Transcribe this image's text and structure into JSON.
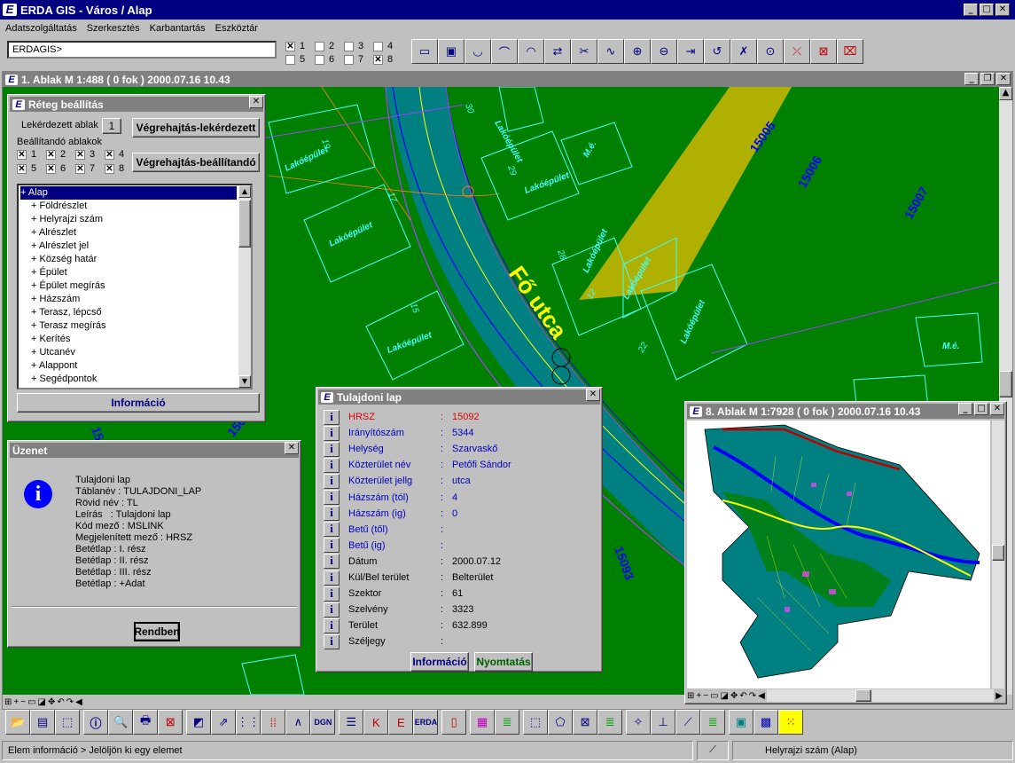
{
  "app": {
    "title": "ERDA GIS - Város / Alap",
    "logo": "ERDA"
  },
  "menu": [
    "Adatszolgáltatás",
    "Szerkesztés",
    "Karbantartás",
    "Eszköztár"
  ],
  "command": {
    "value": "ERDAGIS>"
  },
  "view_checks": [
    {
      "label": "1",
      "checked": true
    },
    {
      "label": "2",
      "checked": false
    },
    {
      "label": "3",
      "checked": false
    },
    {
      "label": "4",
      "checked": false
    },
    {
      "label": "5",
      "checked": false
    },
    {
      "label": "6",
      "checked": false
    },
    {
      "label": "7",
      "checked": false
    },
    {
      "label": "8",
      "checked": true
    }
  ],
  "main_window": {
    "title": "1. Ablak  M 1:488   ( 0 fok )  2000.07.16 10.43"
  },
  "map_labels": {
    "street": "Fő utca",
    "parcels": [
      "15005",
      "15006",
      "15007",
      "15093",
      "15093",
      "15092"
    ],
    "buildings": [
      "Lakóépület",
      "Lakóépület",
      "Lakóépület",
      "Lakóépület",
      "Lakóépület",
      "Lakóépület",
      "Lakóépület",
      "M.é.",
      "M.é.",
      "Lakóépület"
    ],
    "numbers": [
      "19",
      "17",
      "15",
      "29",
      "28",
      "22",
      "30",
      "12"
    ]
  },
  "layer_window": {
    "title": "Réteg beállítás",
    "queried_label": "Lekérdezett ablak",
    "queried_value": "1",
    "btn_exec_query": "Végrehajtás-lekérdezett",
    "set_label": "Beállítandó ablakok",
    "btn_exec_set": "Végrehajtás-beállítandó",
    "checks": [
      {
        "label": "1",
        "checked": true
      },
      {
        "label": "2",
        "checked": true
      },
      {
        "label": "3",
        "checked": true
      },
      {
        "label": "4",
        "checked": true
      },
      {
        "label": "5",
        "checked": true
      },
      {
        "label": "6",
        "checked": true
      },
      {
        "label": "7",
        "checked": true
      },
      {
        "label": "8",
        "checked": true
      }
    ],
    "layers": [
      "+ Alap",
      "+ Földrészlet",
      "+ Helyrajzi szám",
      "+ Alrészlet",
      "+ Alrészlet jel",
      "+ Község határ",
      "+ Épület",
      "+ Épület megírás",
      "+ Házszám",
      "+ Terasz, lépcső",
      "+ Terasz megírás",
      "+ Kerítés",
      "+ Utcanév",
      "+ Alappont",
      "+ Segédpontok"
    ],
    "selected_index": 0,
    "info_btn": "Információ"
  },
  "message_window": {
    "title": "Üzenet",
    "lines": [
      "Tulajdoni lap",
      "Táblanév : TULAJDONI_LAP",
      "Rövid név : TL",
      "Leírás   : Tulajdoni lap",
      "Kód mező : MSLINK",
      "Megjelenített mező : HRSZ",
      "Betétlap : I. rész",
      "Betétlap : II. rész",
      "Betétlap : III. rész",
      "Betétlap : +Adat"
    ],
    "ok_btn": "Rendben"
  },
  "property_window": {
    "title": "Tulajdoni lap",
    "rows": [
      {
        "key": "HRSZ",
        "value": "15092",
        "highlight": true
      },
      {
        "key": "Irányítószám",
        "value": "5344"
      },
      {
        "key": "Helység",
        "value": "Szarvaskő"
      },
      {
        "key": "Közterület név",
        "value": "Petőfi Sándor"
      },
      {
        "key": "Közterület jellg",
        "value": "utca"
      },
      {
        "key": "Házszám (tól)",
        "value": "4"
      },
      {
        "key": "Házszám (ig)",
        "value": "0"
      },
      {
        "key": "Betű (től)",
        "value": ""
      },
      {
        "key": "Betű (ig)",
        "value": ""
      },
      {
        "key": "Dátum",
        "value": "2000.07.12",
        "dark": true
      },
      {
        "key": "Kül/Bel terület",
        "value": "Belterület",
        "dark": true
      },
      {
        "key": "Szektor",
        "value": "61",
        "dark": true
      },
      {
        "key": "Szelvény",
        "value": "3323",
        "dark": true
      },
      {
        "key": "Terület",
        "value": "632.899",
        "dark": true
      },
      {
        "key": "Széljegy",
        "value": "",
        "dark": true
      }
    ],
    "info_btn": "Információ",
    "print_btn": "Nyomtatás"
  },
  "overview_window": {
    "title": "8. Ablak  M 1:7928   ( 0 fok )  2000.07.16 10.43"
  },
  "status": {
    "left": "Elem információ > Jelöljön ki egy elemet",
    "right": "Helyrajzi szám (Alap)"
  },
  "bottom_tools": [
    "DGN",
    "ERDA"
  ]
}
